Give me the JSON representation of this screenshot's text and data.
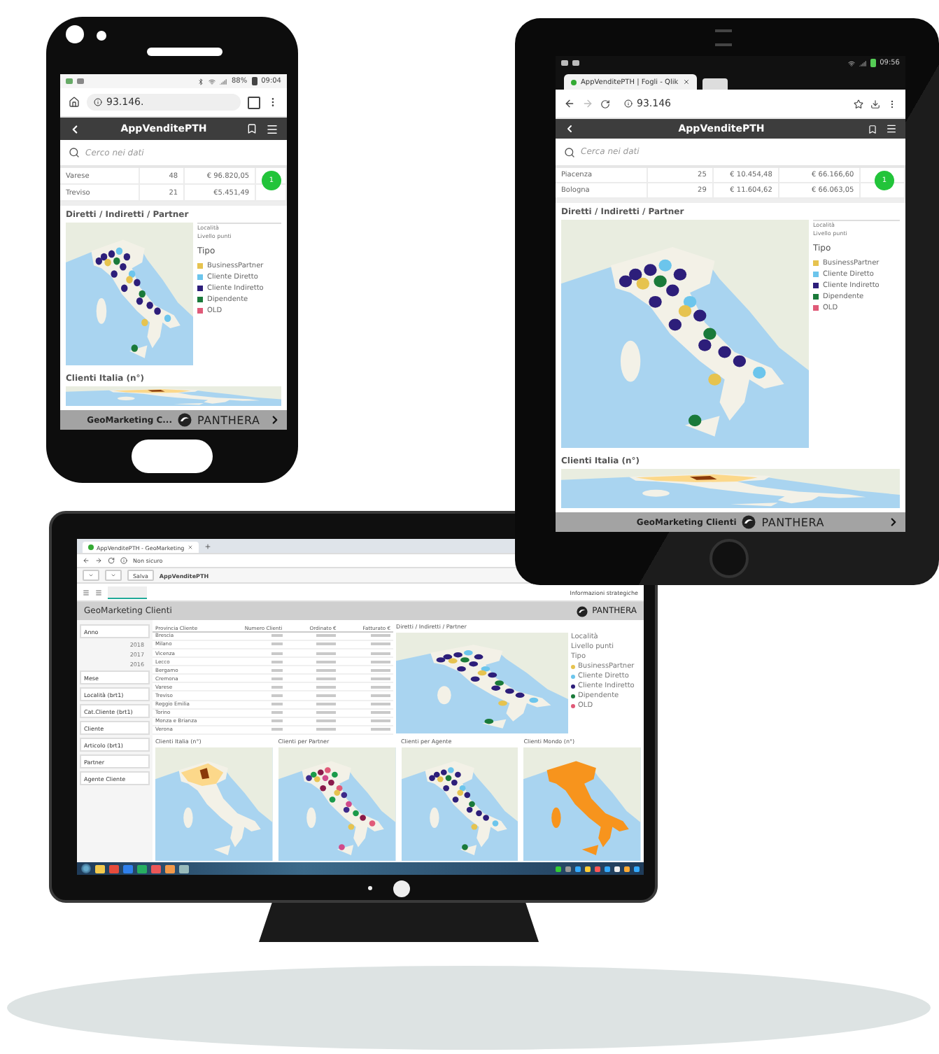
{
  "phone": {
    "status_bar": {
      "battery": "88%",
      "time": "09:04"
    },
    "address": "93.146.",
    "app_title": "AppVenditePTH",
    "search": {
      "placeholder": "Cerco nei dati"
    },
    "table_rows": [
      [
        "Varese",
        "48",
        "€ 96.820,05"
      ],
      [
        "Treviso",
        "21",
        "€5.451,49"
      ]
    ],
    "badge": "1",
    "panels": [
      {
        "title": "Diretti / Indiretti / Partner",
        "kind": "dots",
        "legend_caption": [
          "Località",
          "Livello punti"
        ],
        "legend_title": "Tipo",
        "legend": [
          {
            "label": "BusinessPartner",
            "color": "#e6c34f"
          },
          {
            "label": "Cliente Diretto",
            "color": "#6cc5ec"
          },
          {
            "label": "Cliente Indiretto",
            "color": "#2d1e7a"
          },
          {
            "label": "Dipendente",
            "color": "#1a7a3a"
          },
          {
            "label": "OLD",
            "color": "#e05a78"
          }
        ]
      },
      {
        "title": "Clienti Italia (n°)",
        "kind": "choropleth"
      }
    ],
    "footer": {
      "title": "GeoMarketing C...",
      "brand": "PANTHERA"
    }
  },
  "tablet": {
    "status_bar": {
      "time": "09:56"
    },
    "tab": "AppVenditePTH | Fogli - Qlik",
    "address": "93.146",
    "app_title": "AppVenditePTH",
    "search": {
      "placeholder": "Cerca nei dati"
    },
    "table_rows": [
      [
        "Piacenza",
        "25",
        "€ 10.454,48",
        "€ 66.166,60"
      ],
      [
        "Bologna",
        "29",
        "€ 11.604,62",
        "€ 66.063,05"
      ]
    ],
    "badge": "1",
    "panels": [
      {
        "title": "Diretti / Indiretti / Partner",
        "kind": "dots",
        "legend_caption": [
          "Località",
          "Livello punti"
        ],
        "legend_title": "Tipo",
        "legend": [
          {
            "label": "BusinessPartner",
            "color": "#e6c34f"
          },
          {
            "label": "Cliente Diretto",
            "color": "#6cc5ec"
          },
          {
            "label": "Cliente Indiretto",
            "color": "#2d1e7a"
          },
          {
            "label": "Dipendente",
            "color": "#1a7a3a"
          },
          {
            "label": "OLD",
            "color": "#e05a78"
          }
        ]
      },
      {
        "title": "Clienti Italia (n°)",
        "kind": "choropleth"
      }
    ],
    "footer": {
      "title": "GeoMarketing Clienti",
      "brand": "PANTHERA"
    }
  },
  "monitor": {
    "browser_tab": "AppVenditePTH - GeoMarketing",
    "address": "Non sicuro",
    "toolbar": {
      "button": "Salva",
      "app": "AppVenditePTH"
    },
    "header_link": "Informazioni strategiche",
    "sheet_title": "GeoMarketing Clienti",
    "brand": "PANTHERA",
    "filters": [
      {
        "label": "Anno",
        "values": [
          "2018",
          "2017",
          "2016"
        ]
      },
      {
        "label": "Mese"
      },
      {
        "label": "Località (brt1)"
      },
      {
        "label": "Cat.Cliente (brt1)"
      },
      {
        "label": "Cliente"
      },
      {
        "label": "Articolo (brt1)"
      },
      {
        "label": "Partner"
      },
      {
        "label": "Agente Cliente"
      }
    ],
    "table": {
      "columns": [
        "Provincia Cliente",
        "Numero Clienti",
        "Ordinato €",
        "Fatturato €"
      ],
      "rows": [
        "Brescia",
        "Milano",
        "Vicenza",
        "Lecco",
        "Bergamo",
        "Cremona",
        "Varese",
        "Treviso",
        "Reggio Emilia",
        "Torino",
        "Monza e Brianza",
        "Verona"
      ]
    },
    "top_panel": {
      "title": "Diretti / Indiretti / Partner",
      "kind": "dots",
      "legend_caption": [
        "Località",
        "Livello punti"
      ],
      "legend_title": "Tipo",
      "legend": [
        {
          "label": "BusinessPartner",
          "color": "#e6c34f"
        },
        {
          "label": "Cliente Diretto",
          "color": "#6cc5ec"
        },
        {
          "label": "Cliente Indiretto",
          "color": "#2d1e7a"
        },
        {
          "label": "Dipendente",
          "color": "#1a7a3a"
        },
        {
          "label": "OLD",
          "color": "#e05a78"
        }
      ]
    },
    "bottom_panels": [
      {
        "title": "Clienti Italia (n°)",
        "kind": "choropleth"
      },
      {
        "title": "Clienti per Partner",
        "kind": "multi-dots"
      },
      {
        "title": "Clienti per Agente",
        "kind": "dots"
      },
      {
        "title": "Clienti Mondo (n°)",
        "kind": "orange"
      }
    ]
  }
}
